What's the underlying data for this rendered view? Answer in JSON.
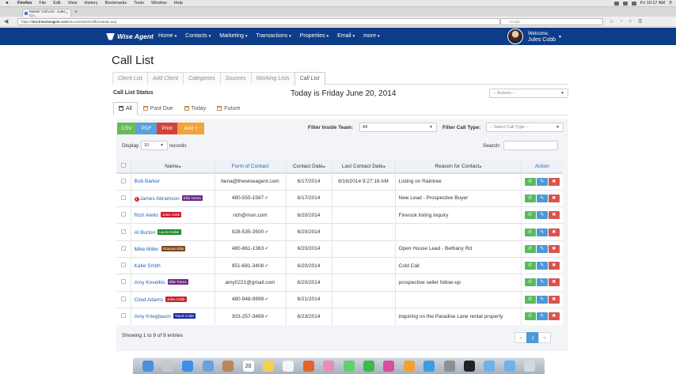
{
  "os_menubar": {
    "items": [
      "Firefox",
      "File",
      "Edit",
      "View",
      "History",
      "Bookmarks",
      "Tools",
      "Window",
      "Help"
    ],
    "clock": "Fri 10:17 AM"
  },
  "browser": {
    "tab_title": "Master Call List - Jules Co...",
    "url_prefix": "https://",
    "url_host": "test.thewiseagent.com",
    "url_path": "/secure/client/callformaster.asp",
    "search_placeholder": "Google"
  },
  "app": {
    "brand": "Wise Agent",
    "menu": [
      {
        "label": "Home"
      },
      {
        "label": "Contacts"
      },
      {
        "label": "Marketing"
      },
      {
        "label": "Transactions"
      },
      {
        "label": "Properties"
      },
      {
        "label": "Email"
      },
      {
        "label": "more"
      }
    ],
    "welcome": "Welcome,",
    "user_name": "Jules Cobb"
  },
  "page": {
    "title": "Call List",
    "subtabs": [
      "Client List",
      "Add Client",
      "Categories",
      "Sources",
      "Working Lists",
      "Call List"
    ],
    "status_label": "Call List Status",
    "today_label": "Today is Friday June 20, 2014",
    "actions_placeholder": "-- Actions --",
    "filter_tabs": [
      "All",
      "Past Due",
      "Today",
      "Future"
    ]
  },
  "toolbar": {
    "csv": "CSV",
    "pdf": "PDF",
    "print": "Print",
    "add": "Add",
    "filter_team_label": "Filter Inside Team:",
    "filter_team_value": "All",
    "filter_type_label": "Filter Call Type:",
    "filter_type_placeholder": "-- Select Call Type --",
    "display_label": "Display",
    "display_value": "10",
    "records_label": "records",
    "search_label": "Search:"
  },
  "table": {
    "headers": {
      "name": "Name",
      "form": "Form of Contact",
      "date": "Contact Date",
      "last": "Last Contact Date",
      "reason": "Reason for Contact",
      "action": "Action"
    },
    "rows": [
      {
        "name": "Bob Barker",
        "alert": false,
        "badge": "",
        "badge_color": "",
        "form": "bena@thewiseagent.com",
        "verified": false,
        "date": "6/17/2014",
        "last": "6/16/2014 9:27:18 AM",
        "reason": "Listing on Raintree"
      },
      {
        "name": "James Abramson",
        "alert": true,
        "badge": "Ellie Torres",
        "badge_color": "#6a2a86",
        "form": "480-555-1587",
        "verified": true,
        "date": "6/17/2014",
        "last": "",
        "reason": "New Lead - Prospective Buyer"
      },
      {
        "name": "Rich Aiello",
        "alert": false,
        "badge": "Jules Cobb",
        "badge_color": "#c8202a",
        "form": "rich@msn.com",
        "verified": false,
        "date": "6/20/2014",
        "last": "",
        "reason": "Firerock listing inquiry"
      },
      {
        "name": "Al Burton",
        "alert": false,
        "badge": "Laurie Keller",
        "badge_color": "#1f8a2e",
        "form": "928-535-3500",
        "verified": true,
        "date": "6/20/2014",
        "last": "",
        "reason": ""
      },
      {
        "name": "Mike Miller",
        "alert": false,
        "badge": "Grayson Ellis",
        "badge_color": "#7a4a1c",
        "form": "480-861-1363",
        "verified": true,
        "date": "6/20/2014",
        "last": "",
        "reason": "Open House Lead - Bethany Rd"
      },
      {
        "name": "Katie Smith",
        "alert": false,
        "badge": "",
        "badge_color": "",
        "form": "951-681-3408",
        "verified": true,
        "date": "6/20/2014",
        "last": "",
        "reason": "Cold Call"
      },
      {
        "name": "Amy Kovelkis",
        "alert": false,
        "badge": "Ellie Torres",
        "badge_color": "#6a2a86",
        "form": "amy0221@gmail.com",
        "verified": false,
        "date": "6/20/2014",
        "last": "",
        "reason": "prospective seller follow-up"
      },
      {
        "name": "Cloid Adams",
        "alert": false,
        "badge": "Jules Cobb",
        "badge_color": "#c8202a",
        "form": "480-948-9999",
        "verified": true,
        "date": "6/21/2014",
        "last": "",
        "reason": ""
      },
      {
        "name": "Amy Kriegbaum",
        "alert": false,
        "badge": "Travis Cobb",
        "badge_color": "#1c2fa8",
        "form": "303-257-3489",
        "verified": true,
        "date": "6/23/2014",
        "last": "",
        "reason": "inquiring on the Paradise Lane rental property"
      }
    ]
  },
  "footer": {
    "showing": "Showing 1 to 9 of 9 entries",
    "prev": "«",
    "page": "1",
    "next": "»"
  },
  "dock": {
    "apps": [
      "finder-icon",
      "launchpad-icon",
      "safari-icon",
      "mail-icon",
      "contacts-icon",
      "calendar-icon",
      "notes-icon",
      "reminders-icon",
      "firefox-icon",
      "photos-icon",
      "messages-icon",
      "facetime-icon",
      "itunes-icon",
      "ibooks-icon",
      "appstore-icon",
      "preferences-icon",
      "terminal-icon",
      "folder-icon",
      "downloads-icon",
      "trash-icon"
    ],
    "calendar_day": "20"
  },
  "colors": {
    "nav_bg": "#0d3c89",
    "link": "#2067b5",
    "csv": "#69b95a",
    "pdf": "#5aa0da",
    "print": "#d2433c",
    "add": "#f0a43a"
  }
}
